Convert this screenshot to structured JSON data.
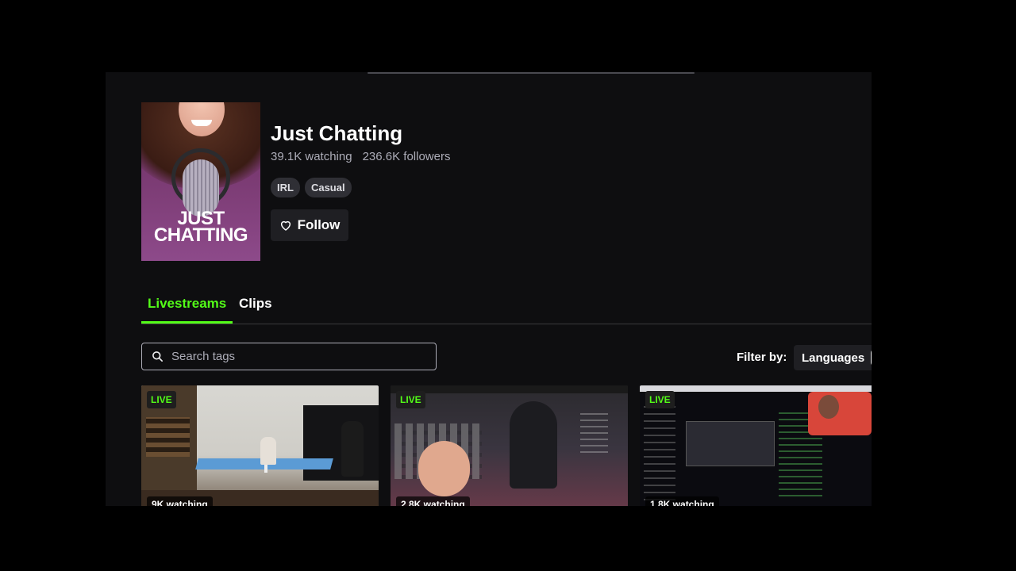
{
  "category": {
    "title": "Just Chatting",
    "cover_text": "JUST CHATTING",
    "watching": "39.1K watching",
    "followers": "236.6K followers",
    "tags": [
      "IRL",
      "Casual"
    ],
    "follow_label": "Follow"
  },
  "tabs": [
    {
      "label": "Livestreams",
      "active": true
    },
    {
      "label": "Clips",
      "active": false
    }
  ],
  "search": {
    "placeholder": "Search tags",
    "value": ""
  },
  "filter": {
    "label": "Filter by:",
    "languages_label": "Languages"
  },
  "streams": [
    {
      "live_label": "LIVE",
      "viewers": "9K watching"
    },
    {
      "live_label": "LIVE",
      "viewers": "2.8K watching"
    },
    {
      "live_label": "LIVE",
      "viewers": "1.8K watching"
    }
  ],
  "colors": {
    "accent": "#53fc18",
    "background": "#0e0e10",
    "page": "#000000"
  },
  "icons": {
    "follow": "heart-icon",
    "search": "search-icon"
  }
}
